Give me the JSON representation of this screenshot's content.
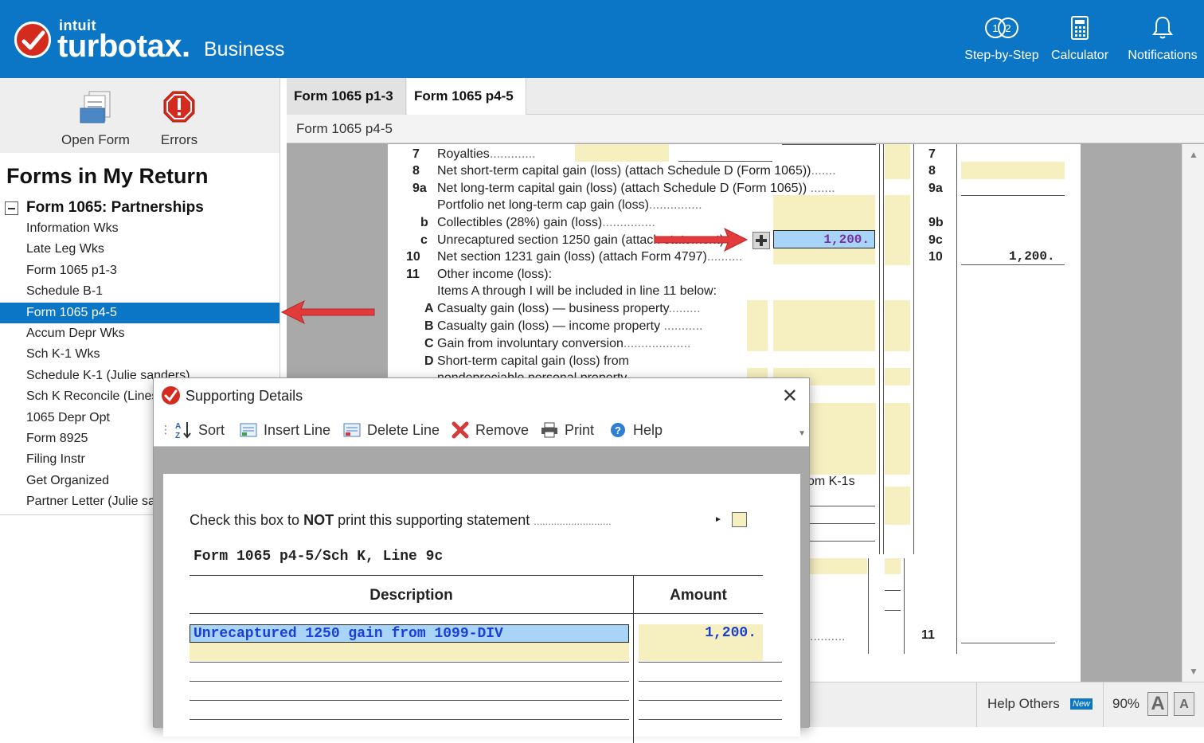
{
  "header": {
    "brand_intuit": "intuit",
    "brand_turbotax": "turbotax.",
    "brand_business": "Business",
    "step_by_step": "Step-by-Step",
    "calculator": "Calculator",
    "notifications": "Notifications"
  },
  "toolbar": {
    "open_form": "Open Form",
    "errors": "Errors"
  },
  "sidebar": {
    "title": "Forms in My Return",
    "root": "Form 1065:  Partnerships",
    "items": [
      "Information Wks",
      "Late Leg Wks",
      "Form 1065 p1-3",
      "Schedule B-1",
      "Form 1065 p4-5",
      "Accum Depr Wks",
      "Sch K-1 Wks",
      "Schedule K-1 (Julie sanders)",
      "Sch K Reconcile (Lines",
      "1065 Depr Opt",
      "Form 8925",
      "Filing Instr",
      "Get Organized",
      "Partner Letter (Julie sa"
    ],
    "selected_index": 4
  },
  "tabs": {
    "tab1": "Form 1065 p1-3",
    "tab2": "Form 1065 p4-5",
    "subtitle": "Form 1065 p4-5"
  },
  "form": {
    "l7_num": "7",
    "l7_text": "Royalties",
    "l8_num": "8",
    "l8_text": "Net short-term capital gain (loss) (attach Schedule D (Form 1065))",
    "l9a_num": "9a",
    "l9a_text": "Net long-term capital gain (loss) (attach Schedule D (Form 1065))",
    "portfolio_text": "Portfolio net long-term cap gain (loss)",
    "l9b_num": "b",
    "l9b_text": "Collectibles (28%) gain (loss)",
    "l9c_num": "c",
    "l9c_text": "Unrecaptured section 1250 gain (attach statement)",
    "l9c_value": "1,200.",
    "l10_num": "10",
    "l10_text": "Net section 1231 gain (loss) (attach Form 4797)",
    "l11_num": "11",
    "l11_text": "Other income (loss):",
    "items_text": "Items A through I will be included in line 11 below:",
    "a_letter": "A",
    "a_text": "Casualty gain (loss) — business property",
    "b_letter": "B",
    "b_text": "Casualty gain (loss) — income property",
    "c_letter": "C",
    "c_text": "Gain from involuntary conversion",
    "d_letter": "D",
    "d_text": "Short-term capital gain (loss) from",
    "d_text2": "nondepreciable personal property",
    "k1s_text": "om K-1s",
    "r7": "7",
    "r8": "8",
    "r9a": "9a",
    "r9b": "9b",
    "r9c": "9c",
    "r10": "10",
    "r10_value": "1,200.",
    "r11": "11"
  },
  "status": {
    "help_others": "Help Others",
    "new_badge": "New",
    "zoom": "90%",
    "font_large": "A",
    "font_small": "A"
  },
  "dialog": {
    "title": "Supporting Details",
    "toolbar": {
      "sort": "Sort",
      "insert": "Insert Line",
      "delete": "Delete Line",
      "remove": "Remove",
      "print": "Print",
      "help": "Help"
    },
    "check_text_1": "Check this box to ",
    "check_text_bold": "NOT",
    "check_text_2": " print this supporting statement",
    "ref": "Form 1065 p4-5/Sch K, Line 9c",
    "col_description": "Description",
    "col_amount": "Amount",
    "row1_desc": "Unrecaptured 1250 gain from 1099-DIV",
    "row1_amount": "1,200."
  },
  "colors": {
    "brand_blue": "#0b76c5",
    "brand_red": "#d52b1e",
    "field_yellow": "#f6efbf",
    "field_selected": "#a7d4f7",
    "value_purple": "#7b2fa0",
    "arrow_red": "#e23b3b"
  }
}
